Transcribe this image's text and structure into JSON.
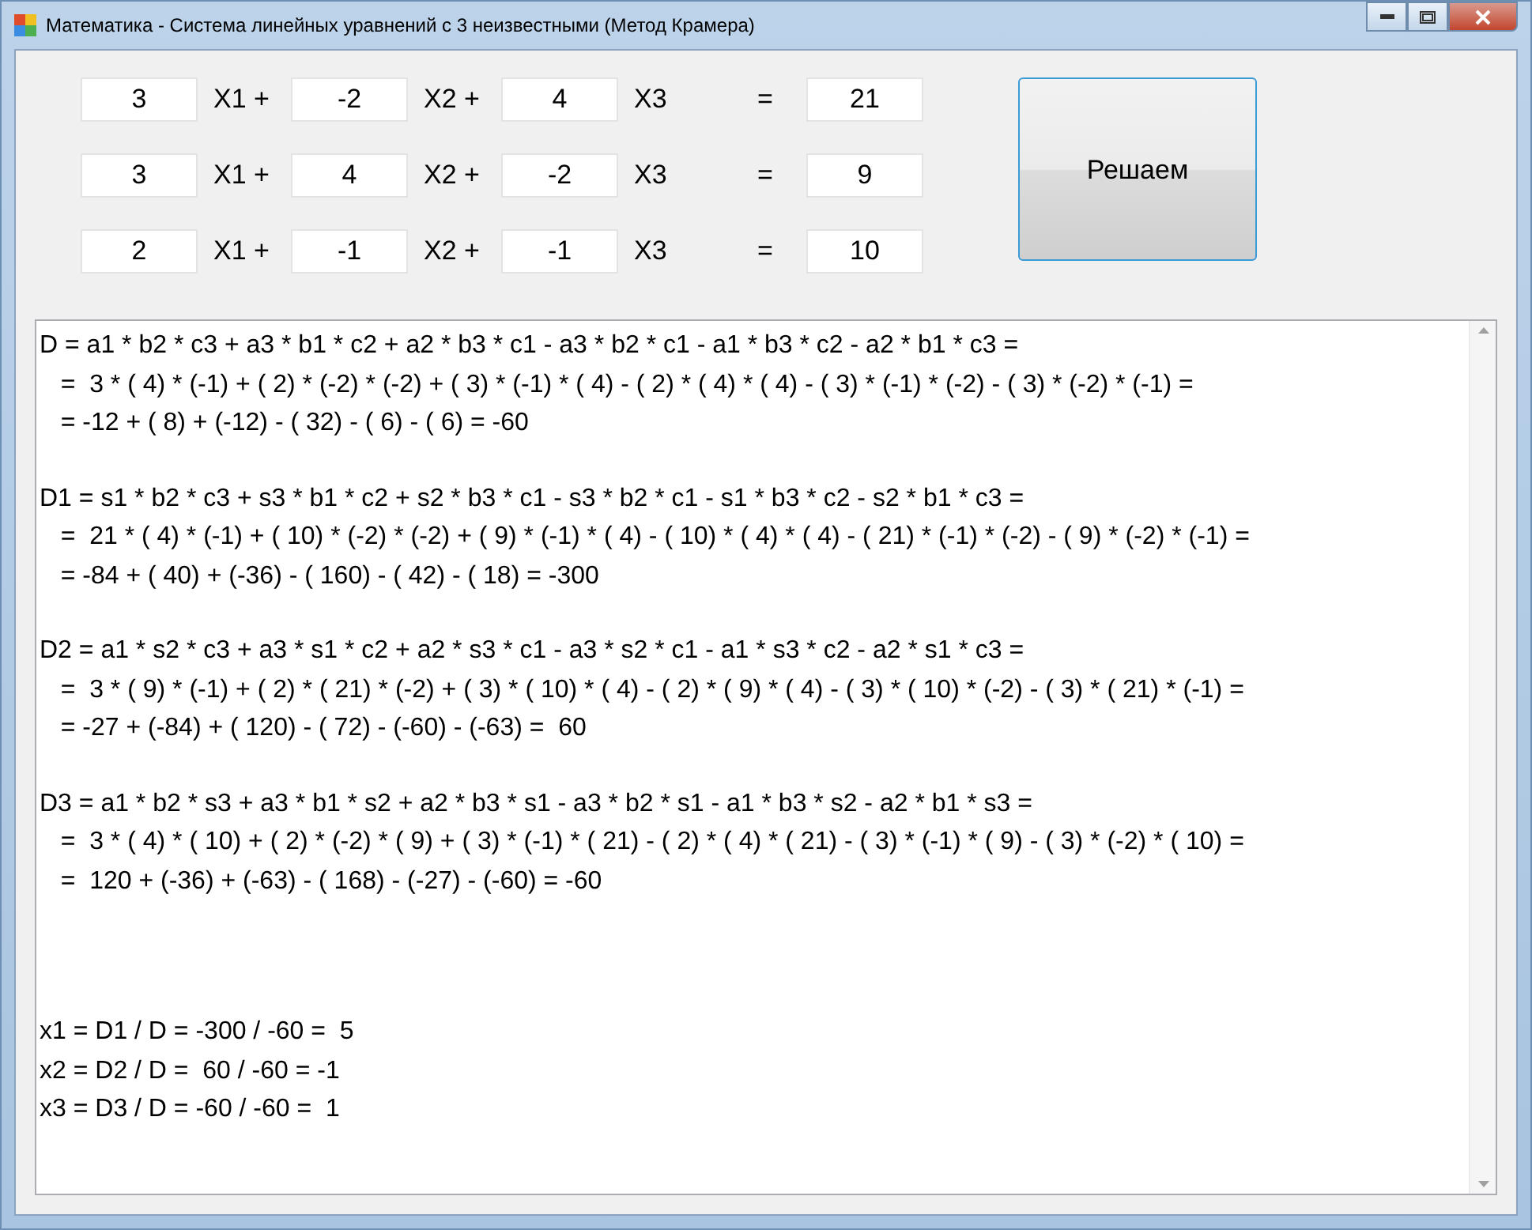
{
  "window": {
    "title": "Математика - Система линейных уравнений с 3 неизвестными (Метод Крамера)"
  },
  "equations": [
    {
      "terms": [
        {
          "value": "3",
          "label": "X1 +"
        },
        {
          "value": "-2",
          "label": "X2 +"
        },
        {
          "value": "4",
          "label": "X3"
        }
      ],
      "equals": "=",
      "rhs": "21"
    },
    {
      "terms": [
        {
          "value": "3",
          "label": "X1 +"
        },
        {
          "value": "4",
          "label": "X2 +"
        },
        {
          "value": "-2",
          "label": "X3"
        }
      ],
      "equals": "=",
      "rhs": "9"
    },
    {
      "terms": [
        {
          "value": "2",
          "label": "X1 +"
        },
        {
          "value": "-1",
          "label": "X2 +"
        },
        {
          "value": "-1",
          "label": "X3"
        }
      ],
      "equals": "=",
      "rhs": "10"
    }
  ],
  "solve_button": "Решаем",
  "output": [
    {
      "kind": "determinant",
      "lines": [
        "D = a1 * b2 * c3 + a3 * b1 * c2 + a2 * b3 * c1 - a3 * b2 * c1 - a1 * b3 * c2 - a2 * b1 * c3 =",
        "   =  3 * ( 4) * (-1) + ( 2) * (-2) * (-2) + ( 3) * (-1) * ( 4) - ( 2) * ( 4) * ( 4) - ( 3) * (-1) * (-2) - ( 3) * (-2) * (-1) =",
        "   = -12 + ( 8) + (-12) - ( 32) - ( 6) - ( 6) = -60"
      ]
    },
    {
      "kind": "determinant",
      "lines": [
        "D1 = s1 * b2 * c3 + s3 * b1 * c2 + s2 * b3 * c1 - s3 * b2 * c1 - s1 * b3 * c2 - s2 * b1 * c3 =",
        "   =  21 * ( 4) * (-1) + ( 10) * (-2) * (-2) + ( 9) * (-1) * ( 4) - ( 10) * ( 4) * ( 4) - ( 21) * (-1) * (-2) - ( 9) * (-2) * (-1) =",
        "   = -84 + ( 40) + (-36) - ( 160) - ( 42) - ( 18) = -300"
      ]
    },
    {
      "kind": "determinant",
      "lines": [
        "D2 = a1 * s2 * c3 + a3 * s1 * c2 + a2 * s3 * c1 - a3 * s2 * c1 - a1 * s3 * c2 - a2 * s1 * c3 =",
        "   =  3 * ( 9) * (-1) + ( 2) * ( 21) * (-2) + ( 3) * ( 10) * ( 4) - ( 2) * ( 9) * ( 4) - ( 3) * ( 10) * (-2) - ( 3) * ( 21) * (-1) =",
        "   = -27 + (-84) + ( 120) - ( 72) - (-60) - (-63) =  60"
      ]
    },
    {
      "kind": "determinant",
      "lines": [
        "D3 = a1 * b2 * s3 + a3 * b1 * s2 + a2 * b3 * s1 - a3 * b2 * s1 - a1 * b3 * s2 - a2 * b1 * s3 =",
        "   =  3 * ( 4) * ( 10) + ( 2) * (-2) * ( 9) + ( 3) * (-1) * ( 21) - ( 2) * ( 4) * ( 21) - ( 3) * (-1) * ( 9) - ( 3) * (-2) * ( 10) =",
        "   =  120 + (-36) + (-63) - ( 168) - (-27) - (-60) = -60"
      ]
    },
    {
      "kind": "result",
      "lines": [
        "x1 = D1 / D = -300 / -60 =  5",
        "x2 = D2 / D =  60 / -60 = -1",
        "x3 = D3 / D = -60 / -60 =  1"
      ]
    }
  ]
}
